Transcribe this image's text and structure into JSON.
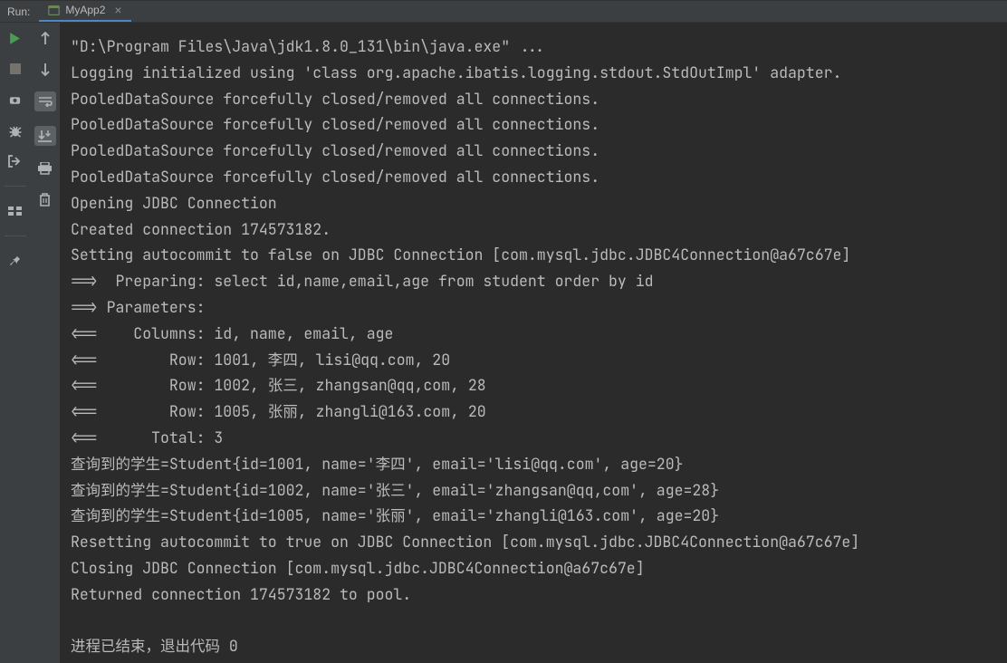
{
  "header": {
    "label": "Run:",
    "tab_name": "MyApp2"
  },
  "console": {
    "lines": [
      "\"D:\\Program Files\\Java\\jdk1.8.0_131\\bin\\java.exe\" ...",
      "Logging initialized using 'class org.apache.ibatis.logging.stdout.StdOutImpl' adapter.",
      "PooledDataSource forcefully closed/removed all connections.",
      "PooledDataSource forcefully closed/removed all connections.",
      "PooledDataSource forcefully closed/removed all connections.",
      "PooledDataSource forcefully closed/removed all connections.",
      "Opening JDBC Connection",
      "Created connection 174573182.",
      "Setting autocommit to false on JDBC Connection [com.mysql.jdbc.JDBC4Connection@a67c67e]",
      "==>  Preparing: select id,name,email,age from student order by id ",
      "==> Parameters: ",
      "<==    Columns: id, name, email, age",
      "<==        Row: 1001, 李四, lisi@qq.com, 20",
      "<==        Row: 1002, 张三, zhangsan@qq,com, 28",
      "<==        Row: 1005, 张丽, zhangli@163.com, 20",
      "<==      Total: 3",
      "查询到的学生=Student{id=1001, name='李四', email='lisi@qq.com', age=20}",
      "查询到的学生=Student{id=1002, name='张三', email='zhangsan@qq,com', age=28}",
      "查询到的学生=Student{id=1005, name='张丽', email='zhangli@163.com', age=20}",
      "Resetting autocommit to true on JDBC Connection [com.mysql.jdbc.JDBC4Connection@a67c67e]",
      "Closing JDBC Connection [com.mysql.jdbc.JDBC4Connection@a67c67e]",
      "Returned connection 174573182 to pool.",
      "",
      "进程已结束，退出代码 0"
    ]
  }
}
